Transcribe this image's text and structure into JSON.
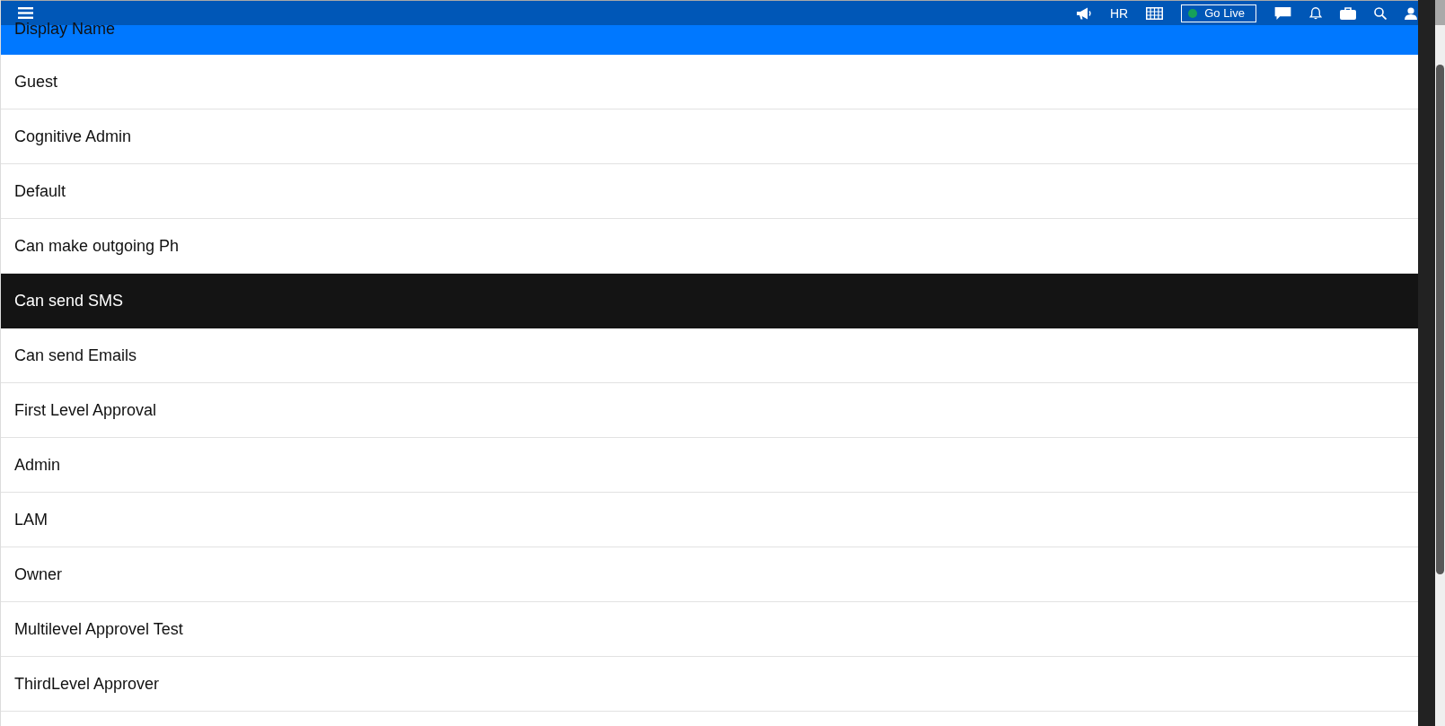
{
  "top_bar": {
    "department": "HR",
    "go_live_button": "Go Live"
  },
  "table": {
    "columns": [
      "Display Name"
    ],
    "rows": [
      {
        "display_name": "Guest",
        "selected": false
      },
      {
        "display_name": "Cognitive Admin",
        "selected": false
      },
      {
        "display_name": "Default",
        "selected": false
      },
      {
        "display_name": "Can make outgoing Ph",
        "selected": false
      },
      {
        "display_name": "Can send SMS",
        "selected": true
      },
      {
        "display_name": "Can send Emails",
        "selected": false
      },
      {
        "display_name": "First Level Approval",
        "selected": false
      },
      {
        "display_name": "Admin",
        "selected": false
      },
      {
        "display_name": "LAM",
        "selected": false
      },
      {
        "display_name": "Owner",
        "selected": false
      },
      {
        "display_name": "Multilevel Approvel Test",
        "selected": false
      },
      {
        "display_name": "ThirdLevel Approver",
        "selected": false
      }
    ]
  }
}
